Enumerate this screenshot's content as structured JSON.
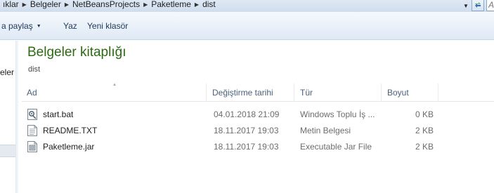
{
  "address_bar": {
    "crumbs": [
      "ıklar",
      "Belgeler",
      "NetBeansProjects",
      "Paketleme",
      "dist"
    ],
    "search_placeholder": "Ara: dist"
  },
  "toolbar": {
    "share_label": "a paylaş",
    "burn_label": "Yaz",
    "new_folder_label": "Yeni klasör"
  },
  "navpane": {
    "partial_item": "eler"
  },
  "library": {
    "title": "Belgeler kitaplığı",
    "subtitle": "dist"
  },
  "columns": {
    "name": "Ad",
    "date": "Değiştirme tarihi",
    "type": "Tür",
    "size": "Boyut"
  },
  "files": [
    {
      "name": "start.bat",
      "date": "04.01.2018 21:09",
      "type": "Windows Toplu İş ...",
      "size": "0 KB",
      "icon": "batch-file-icon"
    },
    {
      "name": "README.TXT",
      "date": "18.11.2017 19:03",
      "type": "Metin Belgesi",
      "size": "2 KB",
      "icon": "text-file-icon"
    },
    {
      "name": "Paketleme.jar",
      "date": "18.11.2017 19:03",
      "type": "Executable Jar File",
      "size": "2 KB",
      "icon": "jar-file-icon"
    }
  ],
  "colors": {
    "library_title": "#2d6a12",
    "column_header": "#4c607a",
    "toolbar_text": "#1e395b"
  }
}
